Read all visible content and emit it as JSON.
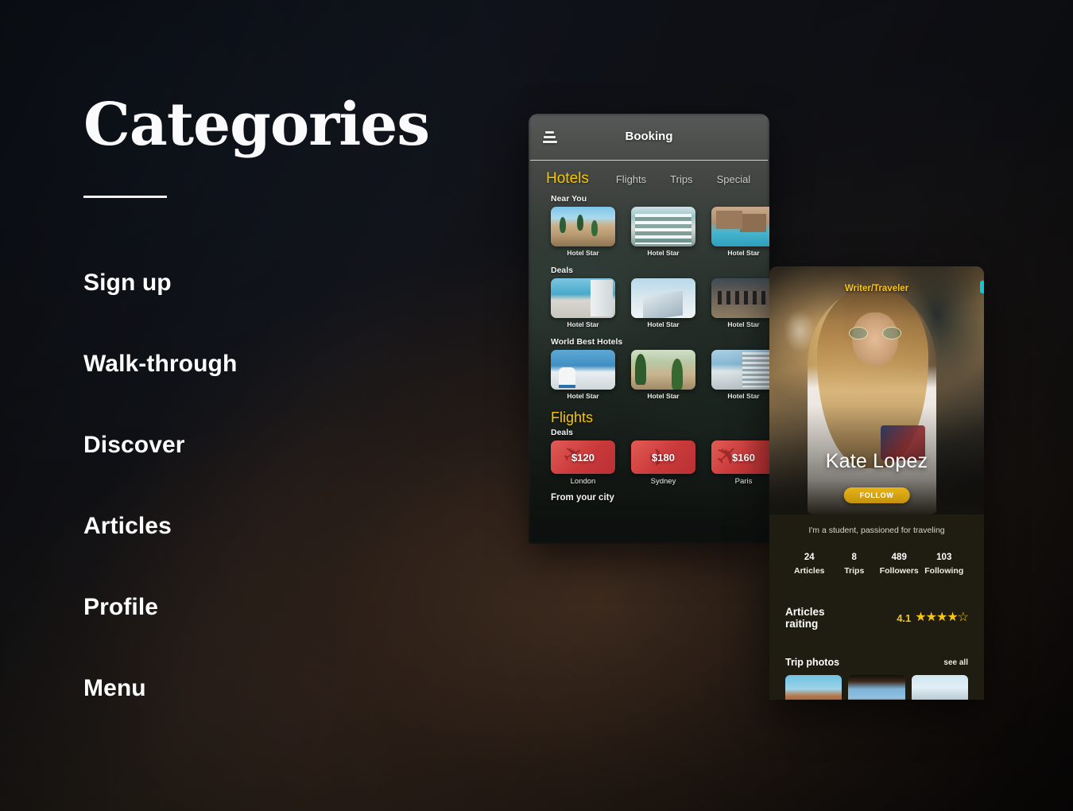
{
  "page": {
    "title": "Categories",
    "nav_items": [
      {
        "label": "Sign up"
      },
      {
        "label": "Walk-through"
      },
      {
        "label": "Discover"
      },
      {
        "label": "Articles"
      },
      {
        "label": "Profile"
      },
      {
        "label": "Menu"
      }
    ]
  },
  "colors": {
    "background_dark": "#0f141b",
    "background_warm": "#241c18",
    "accent_yellow": "#f7c600",
    "accent_gold": "#f5c518",
    "deal_red": "#c9393a",
    "text_primary": "#ffffff"
  },
  "booking_screen": {
    "menu_icon": "hamburger-icon",
    "title": "Booking",
    "tabs": [
      {
        "label": "Hotels",
        "active": true
      },
      {
        "label": "Flights",
        "active": false
      },
      {
        "label": "Trips",
        "active": false
      },
      {
        "label": "Special",
        "active": false
      }
    ],
    "hotels_heading": "Hotels",
    "sections": [
      {
        "label": "Near You",
        "cards": [
          {
            "caption": "Hotel Star",
            "art": "t1"
          },
          {
            "caption": "Hotel Star",
            "art": "t2"
          },
          {
            "caption": "Hotel Star",
            "art": "t3"
          }
        ]
      },
      {
        "label": "Deals",
        "cards": [
          {
            "caption": "Hotel Star",
            "art": "t4"
          },
          {
            "caption": "Hotel Star",
            "art": "t5"
          },
          {
            "caption": "Hotel Star",
            "art": "t6"
          }
        ]
      },
      {
        "label": "World Best Hotels",
        "cards": [
          {
            "caption": "Hotel Star",
            "art": "t7"
          },
          {
            "caption": "Hotel Star",
            "art": "t8"
          },
          {
            "caption": "Hotel Star",
            "art": "t9"
          }
        ]
      }
    ],
    "flights": {
      "heading": "Flights",
      "deals_label": "Deals",
      "deals": [
        {
          "price": "$120",
          "city": "London"
        },
        {
          "price": "$180",
          "city": "Sydney"
        },
        {
          "price": "$160",
          "city": "Paris"
        }
      ],
      "footer_label": "From your city"
    }
  },
  "profile_screen": {
    "role": "Writer/Traveler",
    "name": "Kate Lopez",
    "follow_label": "FOLLOW",
    "bio": "I'm a student, passioned for traveling",
    "stats": [
      {
        "value": "24",
        "label": "Articles"
      },
      {
        "value": "8",
        "label": "Trips"
      },
      {
        "value": "489",
        "label": "Followers"
      },
      {
        "value": "103",
        "label": "Following"
      }
    ],
    "rating": {
      "label": "Articles raiting",
      "value": "4.1",
      "stars": "★★★★☆"
    },
    "photos": {
      "heading": "Trip photos",
      "see_all_label": "see all",
      "thumbs": [
        "ppi1",
        "ppi2",
        "ppi3"
      ]
    }
  }
}
